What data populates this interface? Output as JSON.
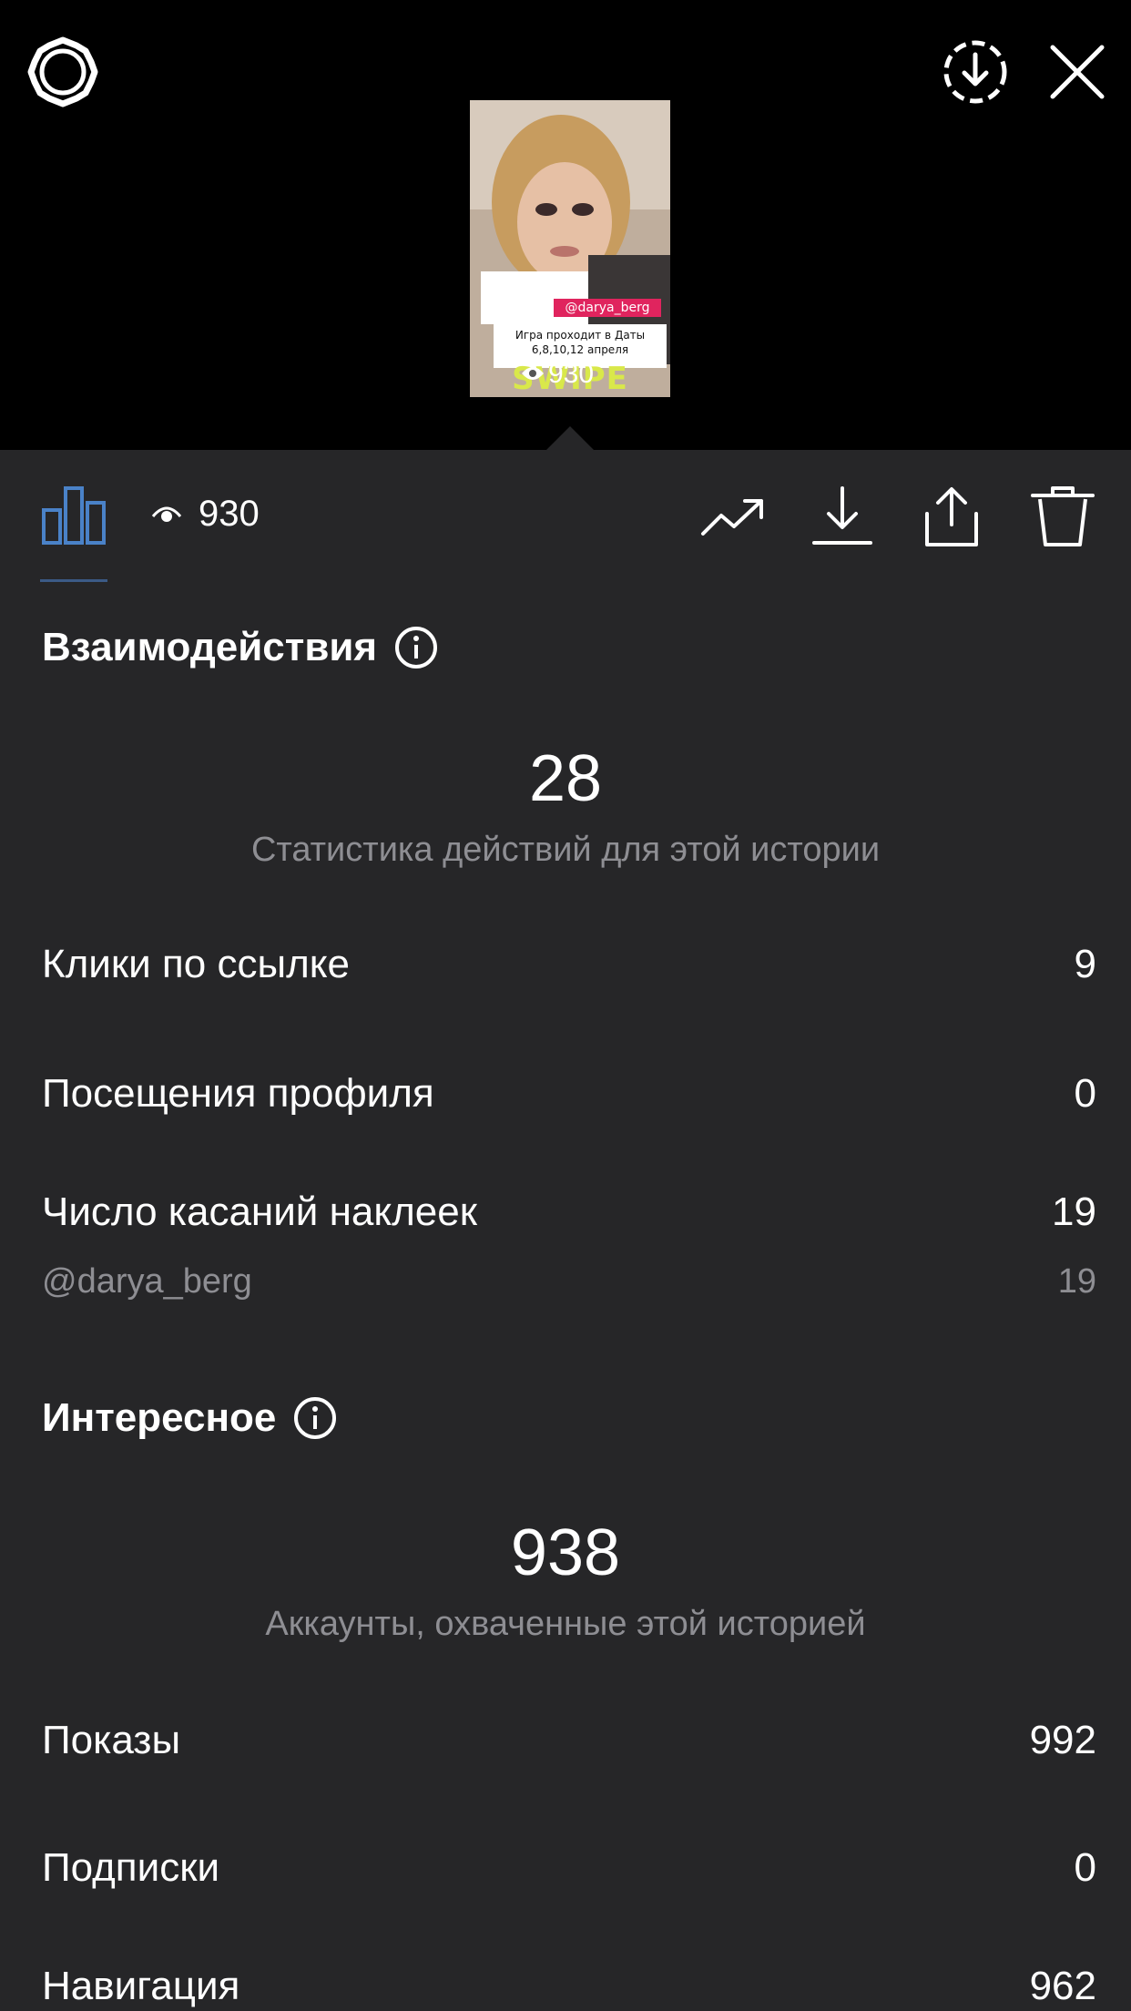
{
  "preview": {
    "tag": "@darya_berg",
    "card_text": "Игра проходит в Даты 6,8,10,12 апреля",
    "overlay": "SWIPE UP!",
    "views": "930"
  },
  "toolbar": {
    "view_count": "930"
  },
  "interactions": {
    "title": "Взаимодействия",
    "total": "28",
    "caption": "Статистика действий для этой истории",
    "rows": [
      {
        "label": "Клики по ссылке",
        "value": "9"
      },
      {
        "label": "Посещения профиля",
        "value": "0"
      },
      {
        "label": "Число касаний наклеек",
        "value": "19"
      }
    ],
    "sticker": {
      "label": "@darya_berg",
      "value": "19"
    }
  },
  "discovery": {
    "title": "Интересное",
    "total": "938",
    "caption": "Аккаунты, охваченные этой историей",
    "rows": [
      {
        "label": "Показы",
        "value": "992"
      },
      {
        "label": "Подписки",
        "value": "0"
      },
      {
        "label": "Навигация",
        "value": "962"
      }
    ]
  },
  "colors": {
    "panel_bg": "#262628",
    "accent_blue": "#4a82c8",
    "muted_text": "#8e8e93"
  },
  "icons": [
    "gear-icon",
    "download-circle-icon",
    "close-icon",
    "bar-chart-icon",
    "eye-icon",
    "trend-icon",
    "download-icon",
    "share-icon",
    "trash-icon",
    "info-icon"
  ]
}
